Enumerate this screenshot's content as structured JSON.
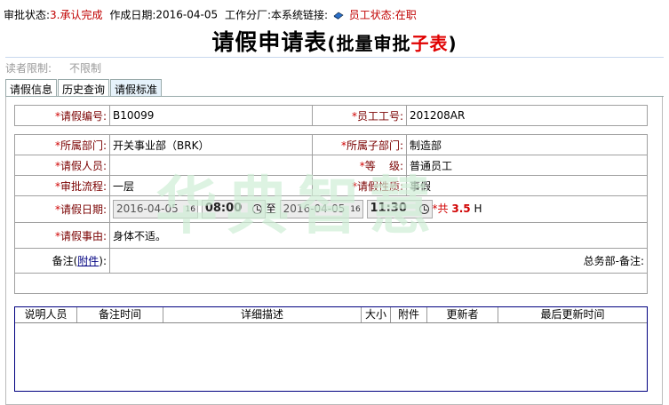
{
  "status": {
    "approval_label": "审批状态:",
    "approval_value": "3.承认完成",
    "date_label": "作成日期:",
    "date_value": "2016-04-05",
    "branch_label": "工作分厂:",
    "link_label": "本系统链接:",
    "employee_label": "员工状态:",
    "employee_value": "在职"
  },
  "title": {
    "main": "请假申请表",
    "open": "(",
    "batch": "批量审批",
    "sub": "子表",
    "close": ")"
  },
  "reader": {
    "label": "读者限制:",
    "value": "不限制"
  },
  "tabs": [
    {
      "label": "请假信息"
    },
    {
      "label": "历史查询"
    },
    {
      "label": "请假标准"
    }
  ],
  "watermark": "华典智慧",
  "form": {
    "leave_no_label": "请假编号:",
    "leave_no": "B10099",
    "emp_no_label": "员工工号:",
    "emp_no": "201208AR",
    "dept_label": "所属部门:",
    "dept": "开关事业部（BRK）",
    "subdept_label": "所属子部门:",
    "subdept": "制造部",
    "person_label": "请假人员:",
    "person": "",
    "grade_label": "等    级:",
    "grade": "普通员工",
    "flow_label": "审批流程:",
    "flow": "一层",
    "nature_label": "请假性质:",
    "nature": "事假",
    "date_label": "请假日期:",
    "start_date": "2016-04-05",
    "start_time": "08:00",
    "to": "至",
    "end_date": "2016-04-05",
    "end_time": "11:30",
    "total_prefix": "*共",
    "total_hours": "3.5",
    "total_unit": "H",
    "reason_label": "请假事由:",
    "reason": "身体不适。",
    "remark_label_pre": "备注(",
    "remark_attach": "附件",
    "remark_label_post": "):",
    "gm_remark": "总务部-备注:"
  },
  "grid": {
    "columns": [
      "说明人员",
      "备注时间",
      "详细描述",
      "大小",
      "附件",
      "更新者",
      "最后更新时间"
    ]
  }
}
